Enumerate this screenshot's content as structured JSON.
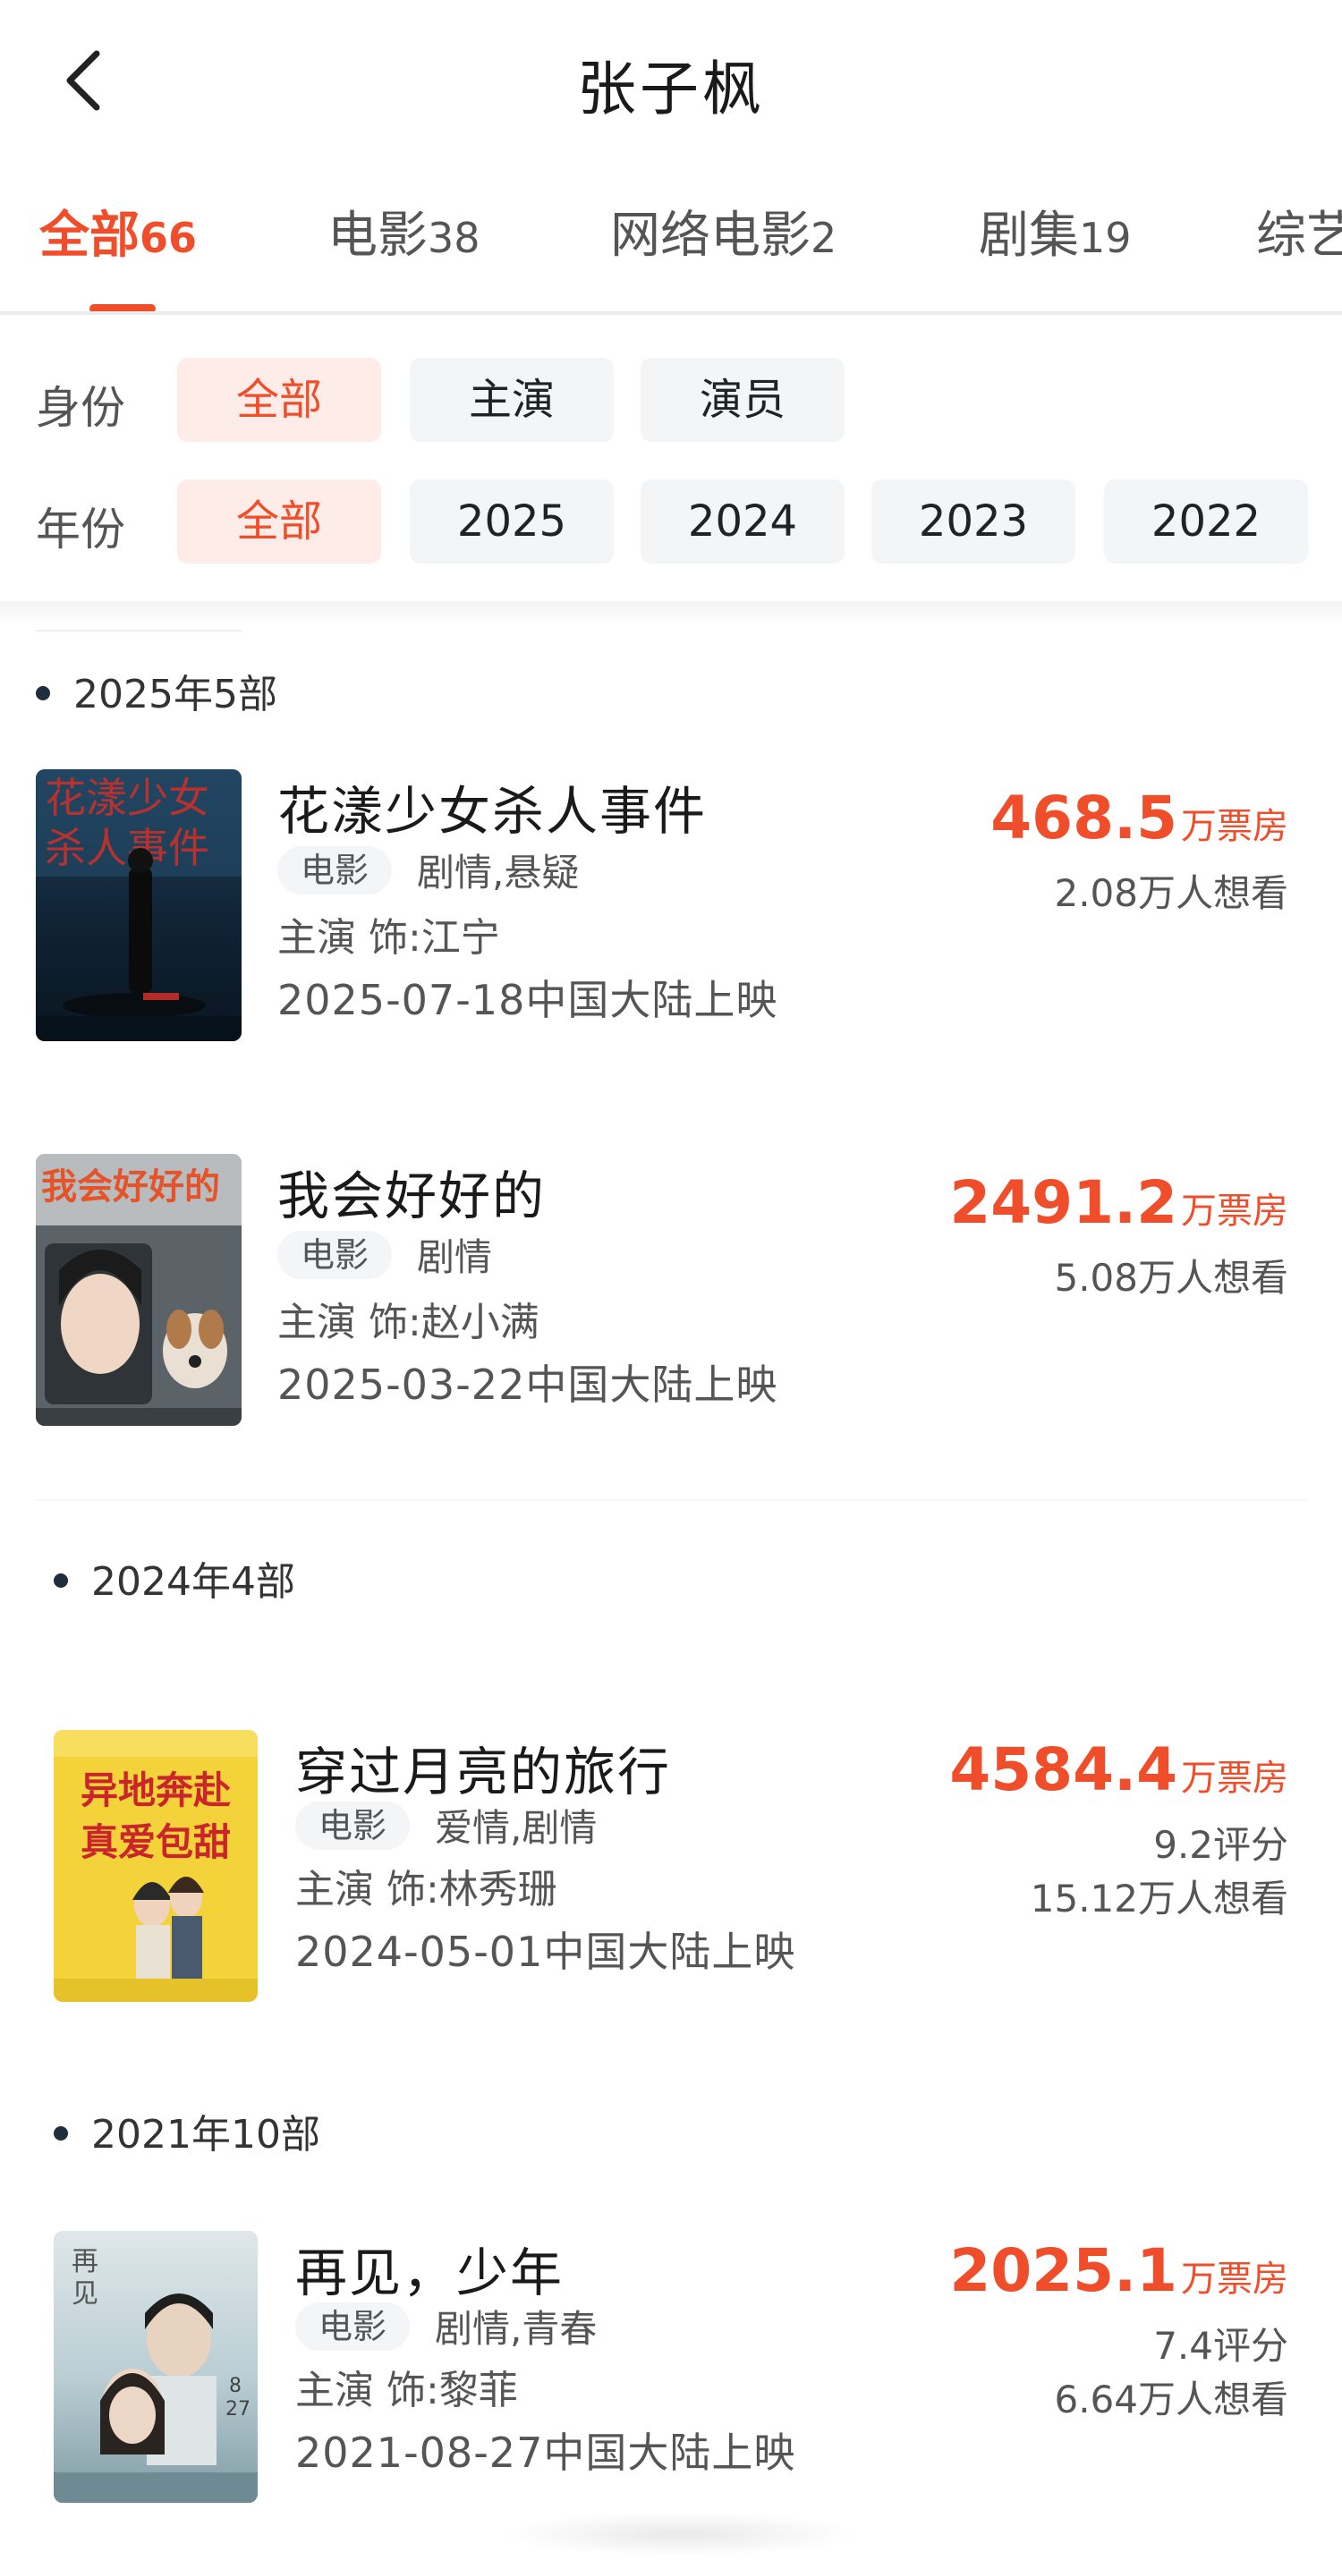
{
  "header": {
    "title": "张子枫"
  },
  "tabs": [
    {
      "label": "全部",
      "count": "66",
      "active": true
    },
    {
      "label": "电影",
      "count": "38"
    },
    {
      "label": "网络电影",
      "count": "2"
    },
    {
      "label": "剧集",
      "count": "19"
    },
    {
      "label": "综艺",
      "count": ""
    }
  ],
  "filters": {
    "identity": {
      "label": "身份",
      "options": [
        "全部",
        "主演",
        "演员"
      ],
      "selected": "全部"
    },
    "year": {
      "label": "年份",
      "options": [
        "全部",
        "2025",
        "2024",
        "2023",
        "2022"
      ],
      "selected": "全部"
    }
  },
  "groups": [
    {
      "label": "2025年5部",
      "movies": [
        {
          "title": "花漾少女杀人事件",
          "type": "电影",
          "genre": "剧情,悬疑",
          "role": "主演 饰:江宁",
          "release": "2025-07-18中国大陆上映",
          "box_office": "468.5",
          "box_unit": "万票房",
          "wants": "2.08万人想看",
          "poster_icon": "dark-street-poster"
        },
        {
          "title": "我会好好的",
          "type": "电影",
          "genre": "剧情",
          "role": "主演 饰:赵小满",
          "release": "2025-03-22中国大陆上映",
          "box_office": "2491.2",
          "box_unit": "万票房",
          "wants": "5.08万人想看",
          "poster_icon": "girl-and-dog-poster"
        }
      ]
    },
    {
      "label": "2024年4部",
      "movies": [
        {
          "title": "穿过月亮的旅行",
          "type": "电影",
          "genre": "爱情,剧情",
          "role": "主演 饰:林秀珊",
          "release": "2024-05-01中国大陆上映",
          "box_office": "4584.4",
          "box_unit": "万票房",
          "rating": "9.2评分",
          "wants": "15.12万人想看",
          "poster_icon": "yellow-romance-poster",
          "poster_text": [
            "异地奔赴",
            "真爱包甜"
          ]
        }
      ]
    },
    {
      "label": "2021年10部",
      "movies": [
        {
          "title": "再见，少年",
          "type": "电影",
          "genre": "剧情,青春",
          "role": "主演 饰:黎菲",
          "release": "2021-08-27中国大陆上映",
          "box_office": "2025.1",
          "box_unit": "万票房",
          "rating": "7.4评分",
          "wants": "6.64万人想看",
          "poster_icon": "youth-pair-poster"
        }
      ]
    }
  ],
  "colors": {
    "accent": "#f04d2b",
    "chip_bg": "#f4f5f7",
    "chip_active_bg": "#fdece7"
  }
}
